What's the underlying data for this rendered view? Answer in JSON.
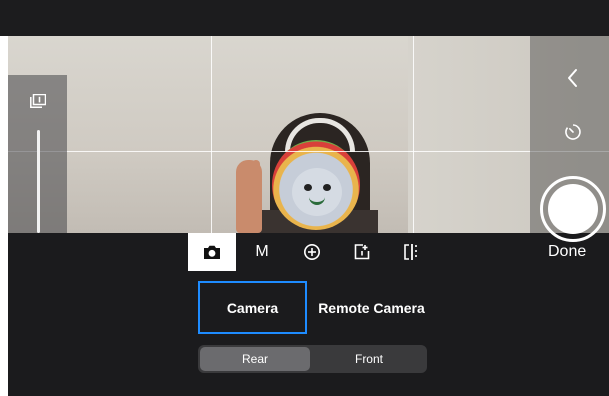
{
  "mode_tabs": [
    {
      "icon": "camera-icon",
      "label": ""
    },
    {
      "icon": "",
      "label": "M"
    },
    {
      "icon": "plus-circle-icon",
      "label": ""
    },
    {
      "icon": "add-frame-icon",
      "label": ""
    },
    {
      "icon": "compare-split-icon",
      "label": ""
    }
  ],
  "done_label": "Done",
  "source_options": [
    "Camera",
    "Remote Camera"
  ],
  "selected_source": "Camera",
  "lens_options": [
    "Rear",
    "Front"
  ],
  "selected_lens": "Rear",
  "icons": {
    "zoom": "zoom-1x-icon",
    "back": "chevron-left-icon",
    "timer": "timer-icon",
    "shutter": "shutter-button"
  },
  "colors": {
    "accent": "#1e8cff",
    "panel": "#1b1b1d"
  }
}
